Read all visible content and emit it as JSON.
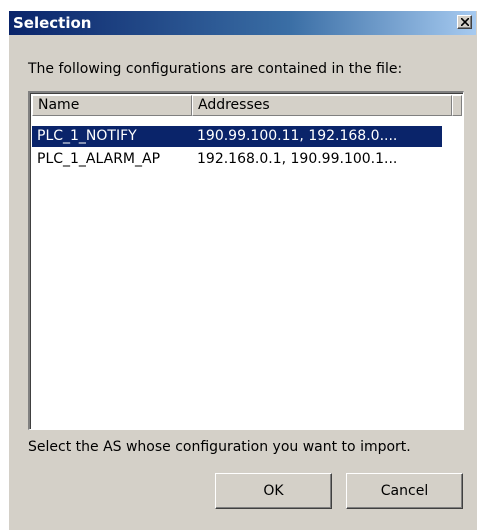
{
  "window": {
    "title": "Selection"
  },
  "instruction": "The following configurations are contained in the file:",
  "list": {
    "columns": [
      "Name",
      "Addresses"
    ],
    "rows": [
      {
        "name": "PLC_1_NOTIFY",
        "addresses": "190.99.100.11, 192.168.0....",
        "selected": true
      },
      {
        "name": "PLC_1_ALARM_AP",
        "addresses": "192.168.0.1, 190.99.100.1...",
        "selected": false
      }
    ]
  },
  "footer_text": "Select the AS whose configuration you want to import.",
  "buttons": {
    "ok": "OK",
    "cancel": "Cancel"
  },
  "colors": {
    "dialog_face": "#d4d0c8",
    "title_active": "#0a246a",
    "selection": "#0a246a"
  },
  "icons": {
    "close": "close-x-icon"
  }
}
